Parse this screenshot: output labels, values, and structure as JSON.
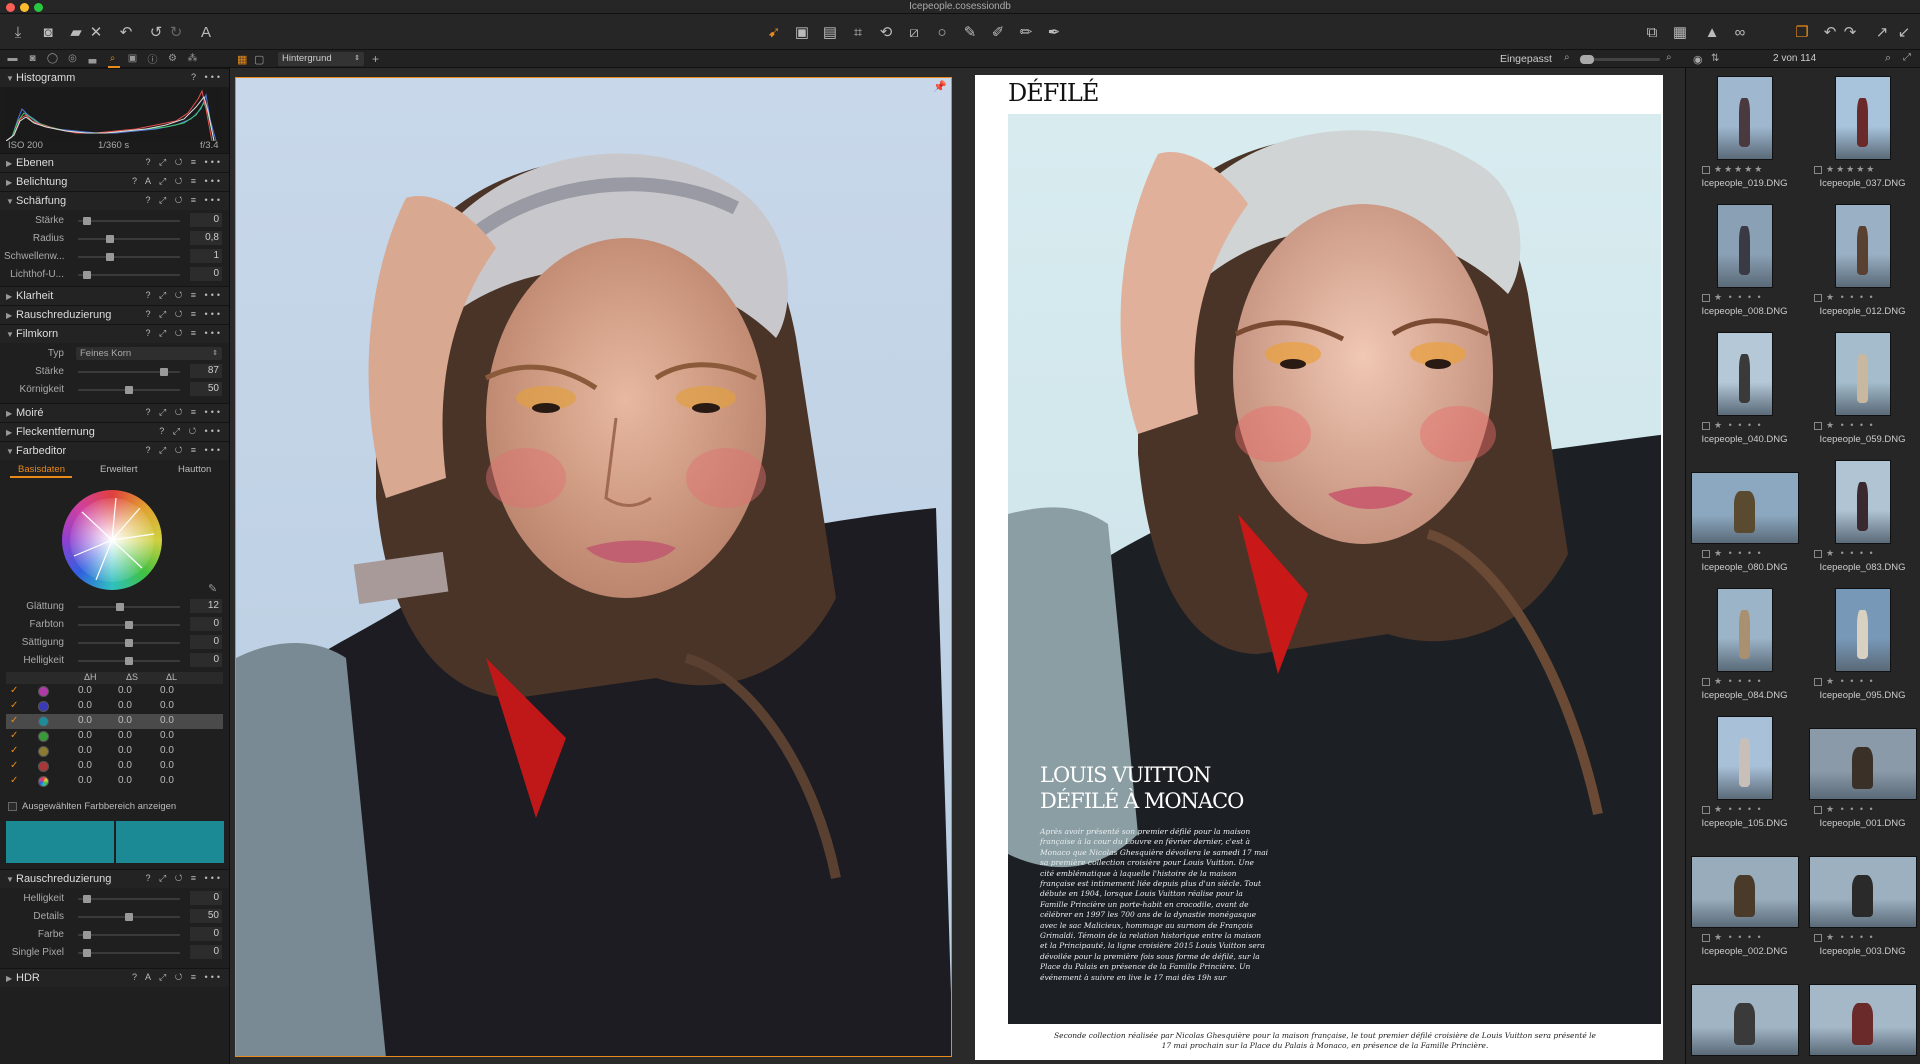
{
  "window": {
    "title": "Icepeople.cosessiondb"
  },
  "viewer": {
    "background_label": "Hintergrund",
    "zoom_label": "Eingepasst",
    "counter": "2 von 114"
  },
  "tools": {
    "histogram": {
      "title": "Histogramm",
      "iso": "ISO 200",
      "shutter": "1/360 s",
      "aperture": "f/3.4"
    },
    "sections_collapsed_top": [
      {
        "label": "Ebenen"
      },
      {
        "label": "Belichtung"
      }
    ],
    "sharpening": {
      "title": "Schärfung",
      "rows": [
        {
          "label": "Stärke",
          "value": "0",
          "pos": 0.05
        },
        {
          "label": "Radius",
          "value": "0,8",
          "pos": 0.3
        },
        {
          "label": "Schwellenw...",
          "value": "1",
          "pos": 0.3
        },
        {
          "label": "Lichthof-U...",
          "value": "0",
          "pos": 0.05
        }
      ]
    },
    "sections_mid": [
      {
        "label": "Klarheit"
      },
      {
        "label": "Rauschreduzierung"
      }
    ],
    "grain": {
      "title": "Filmkorn",
      "type_label": "Typ",
      "type_value": "Feines Korn",
      "rows": [
        {
          "label": "Stärke",
          "value": "87",
          "pos": 0.87
        },
        {
          "label": "Körnigkeit",
          "value": "50",
          "pos": 0.5
        }
      ]
    },
    "sections_lower": [
      {
        "label": "Moiré"
      },
      {
        "label": "Fleckentfernung"
      }
    ],
    "color_editor": {
      "title": "Farbeditor",
      "tabs": [
        "Basisdaten",
        "Erweitert",
        "Hautton"
      ],
      "rows": [
        {
          "label": "Glättung",
          "value": "12",
          "pos": 0.4
        },
        {
          "label": "Farbton",
          "value": "0",
          "pos": 0.5
        },
        {
          "label": "Sättigung",
          "value": "0",
          "pos": 0.5
        },
        {
          "label": "Helligkeit",
          "value": "0",
          "pos": 0.5
        }
      ],
      "headers": [
        "ΔH",
        "ΔS",
        "ΔL"
      ],
      "color_rows": [
        {
          "color": "#b03aa8",
          "h": "0.0",
          "s": "0.0",
          "l": "0.0"
        },
        {
          "color": "#3a3ab8",
          "h": "0.0",
          "s": "0.0",
          "l": "0.0"
        },
        {
          "color": "#1e8a9a",
          "h": "0.0",
          "s": "0.0",
          "l": "0.0"
        },
        {
          "color": "#3a9a3a",
          "h": "0.0",
          "s": "0.0",
          "l": "0.0"
        },
        {
          "color": "#8a7a32",
          "h": "0.0",
          "s": "0.0",
          "l": "0.0"
        },
        {
          "color": "#a83838",
          "h": "0.0",
          "s": "0.0",
          "l": "0.0"
        },
        {
          "color": "rainbow",
          "h": "0.0",
          "s": "0.0",
          "l": "0.0"
        }
      ],
      "show_range_label": "Ausgewählten Farbbereich anzeigen",
      "swatch_color": "#1b8a94"
    },
    "noise2": {
      "title": "Rauschreduzierung",
      "rows": [
        {
          "label": "Helligkeit",
          "value": "0",
          "pos": 0.05
        },
        {
          "label": "Details",
          "value": "50",
          "pos": 0.5
        },
        {
          "label": "Farbe",
          "value": "0",
          "pos": 0.05
        },
        {
          "label": "Single Pixel",
          "value": "0",
          "pos": 0.05
        }
      ]
    },
    "hdr": {
      "title": "HDR"
    }
  },
  "magazine": {
    "header": "DÉFILÉ",
    "headline1": "LOUIS VUITTON",
    "headline2": "DÉFILÉ À MONACO",
    "body": "Après avoir présenté son premier défilé pour la maison française à la cour du Louvre en février dernier, c'est à Monaco que Nicolas Ghesquière dévoilera le samedi 17 mai sa première collection croisière pour Louis Vuitton. Une cité emblématique à laquelle l'histoire de la maison française est intimement liée depuis plus d'un siècle. Tout débute en 1904, lorsque Louis Vuitton réalise pour la Famille Princière un porte-habit en crocodile, avant de célébrer en 1997 les 700 ans de la dynastie monégasque avec le sac Malicieux, hommage au surnom de François Grimaldi. Témoin de la relation historique entre la maison et la Principauté, la ligne croisière 2015 Louis Vuitton sera dévoilée pour la première fois sous forme de défilé, sur la Place du Palais en présence de la Famille Princière. Un événement à suivre en live le 17 mai dès 19h sur",
    "caption": "Seconde collection réalisée par Nicolas Ghesquière pour la maison française, le tout premier défilé croisière de Louis Vuitton sera présenté le 17 mai prochain sur la Place du Palais à Monaco, en présence de la Famille Princière."
  },
  "browser": {
    "items": [
      {
        "name": "Icepeople_019.DNG",
        "stars": "★★★★★",
        "sky": "#9fb8d0",
        "coat": "#4a3a40"
      },
      {
        "name": "Icepeople_037.DNG",
        "stars": "★★★★★",
        "sky": "#a8c4dc",
        "coat": "#6a2a2a"
      },
      {
        "name": "Icepeople_008.DNG",
        "stars": "★ • • • •",
        "sky": "#8aa0b4",
        "coat": "#3a3a44"
      },
      {
        "name": "Icepeople_012.DNG",
        "stars": "★ • • • •",
        "sky": "#9ab0c4",
        "coat": "#5a4030"
      },
      {
        "name": "Icepeople_040.DNG",
        "stars": "★ • • • •",
        "sky": "#b4c8d8",
        "coat": "#3a3a3a"
      },
      {
        "name": "Icepeople_059.DNG",
        "stars": "★ • • • •",
        "sky": "#a4bccc",
        "coat": "#c8b8a0"
      },
      {
        "name": "Icepeople_080.DNG",
        "stars": "★ • • • •",
        "sky": "#8ca8c0",
        "coat": "#5a4a30"
      },
      {
        "name": "Icepeople_083.DNG",
        "stars": "★ • • • •",
        "sky": "#b0c4d4",
        "coat": "#3a2a30"
      },
      {
        "name": "Icepeople_084.DNG",
        "stars": "★ • • • •",
        "sky": "#9cb4c8",
        "coat": "#a89070"
      },
      {
        "name": "Icepeople_095.DNG",
        "stars": "★ • • • •",
        "sky": "#7898b8",
        "coat": "#d8d0c0"
      },
      {
        "name": "Icepeople_105.DNG",
        "stars": "★ • • • •",
        "sky": "#a8c0d8",
        "coat": "#c8c0b8"
      },
      {
        "name": "Icepeople_001.DNG",
        "stars": "★ • • • •",
        "sky": "#8a9aa8",
        "coat": "#3a3028"
      },
      {
        "name": "Icepeople_002.DNG",
        "stars": "★ • • • •",
        "sky": "#98acbc",
        "coat": "#4a3a2a"
      },
      {
        "name": "Icepeople_003.DNG",
        "stars": "★ • • • •",
        "sky": "#9cb0c0",
        "coat": "#2a2a2a"
      },
      {
        "name": "",
        "stars": "",
        "sky": "#a0b4c4",
        "coat": "#3a3a3a"
      },
      {
        "name": "",
        "stars": "",
        "sky": "#a4b8c8",
        "coat": "#6a2a2a"
      }
    ]
  },
  "colors": {
    "accent": "#e8891c"
  }
}
